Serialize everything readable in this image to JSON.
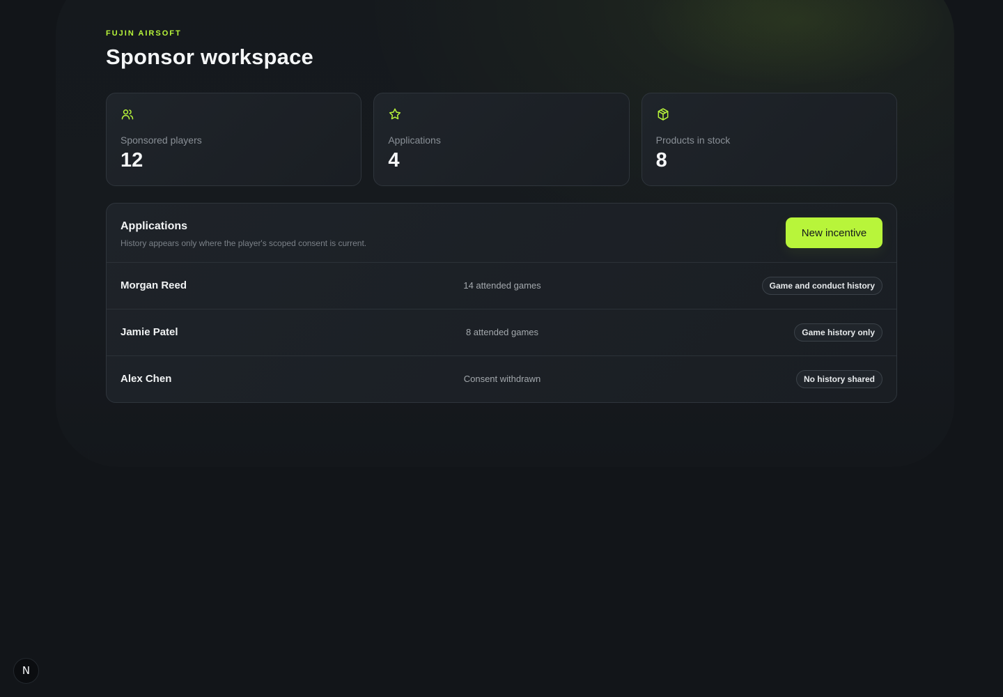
{
  "brand": "FUJIN AIRSOFT",
  "page_title": "Sponsor workspace",
  "colors": {
    "accent": "#b8f53a",
    "background": "#121519",
    "card": "#1c2126"
  },
  "stats": [
    {
      "icon": "users-icon",
      "label": "Sponsored players",
      "value": "12"
    },
    {
      "icon": "star-icon",
      "label": "Applications",
      "value": "4"
    },
    {
      "icon": "package-icon",
      "label": "Products in stock",
      "value": "8"
    }
  ],
  "applications": {
    "title": "Applications",
    "subtitle": "History appears only where the player's scoped consent is current.",
    "new_incentive_label": "New incentive",
    "rows": [
      {
        "name": "Morgan Reed",
        "meta": "14 attended games",
        "badge": "Game and conduct history"
      },
      {
        "name": "Jamie Patel",
        "meta": "8 attended games",
        "badge": "Game history only"
      },
      {
        "name": "Alex Chen",
        "meta": "Consent withdrawn",
        "badge": "No history shared"
      }
    ]
  },
  "dev_badge": "N"
}
